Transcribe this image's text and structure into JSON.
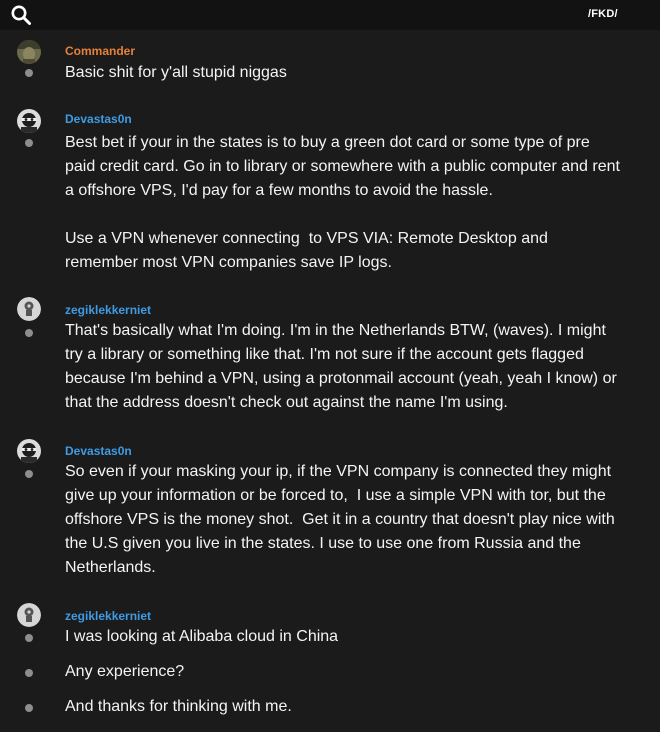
{
  "header": {
    "search_icon": "search-icon",
    "group_tag": "/FKD/"
  },
  "messages": [
    {
      "author": "Commander",
      "author_color": "#e5813a",
      "lines": [
        "Basic shit for y'all stupid niggas"
      ]
    },
    {
      "author": "Devastas0n",
      "author_color": "#3f9be3",
      "lines": [
        "Best bet if your in the states is to buy a green dot card or some type of pre\npaid credit card. Go in to library or somewhere with a public computer and rent\na offshore VPS, I'd pay for a few months to avoid the hassle.\n\nUse a VPN whenever connecting  to VPS VIA: Remote Desktop and\nremember most VPN companies save IP logs."
      ]
    },
    {
      "author": "zegiklekkerniet",
      "author_color": "#3f9be3",
      "lines": [
        "That's basically what I'm doing. I'm in the Netherlands BTW, (waves). I might\ntry a library or something like that. I'm not sure if the account gets flagged\nbecause I'm behind a VPN, using a protonmail account (yeah, yeah I know) or\nthat the address doesn't check out against the name I'm using."
      ]
    },
    {
      "author": "Devastas0n",
      "author_color": "#3f9be3",
      "lines": [
        "So even if your masking your ip, if the VPN company is connected they might\ngive up your information or be forced to,  I use a simple VPN with tor, but the\noffshore VPS is the money shot.  Get it in a country that doesn't play nice with\nthe U.S given you live in the states. I use to use one from Russia and the\nNetherlands."
      ]
    },
    {
      "author": "zegiklekkerniet",
      "author_color": "#3f9be3",
      "lines": [
        "I was looking at Alibaba cloud in China",
        "Any experience?",
        "And thanks for thinking with me."
      ]
    }
  ]
}
